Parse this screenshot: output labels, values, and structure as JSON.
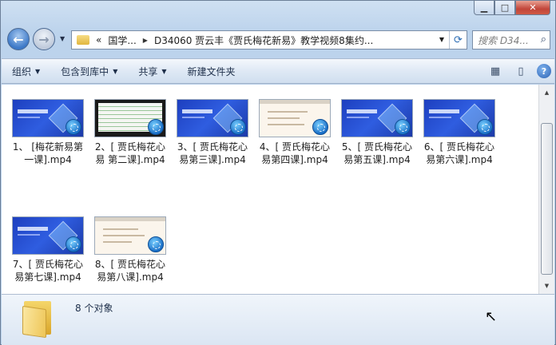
{
  "window": {
    "caption_buttons": {
      "minimize": "▁",
      "maximize": "□",
      "close": "✕"
    }
  },
  "nav": {
    "back_icon": "back-arrow-icon",
    "forward_icon": "forward-arrow-icon",
    "address": {
      "overflow": "«",
      "crumbs": [
        "国学...",
        "D34060 贾云丰《贾氏梅花新易》教学视频8集约..."
      ]
    },
    "search_placeholder": "搜索 D34..."
  },
  "toolbar": {
    "organize": "组织",
    "include_library": "包含到库中",
    "share": "共享",
    "new_folder": "新建文件夹"
  },
  "files": [
    {
      "name": "1、 [梅花新易第\n一课].mp4",
      "thumb": "blue"
    },
    {
      "name": "2、[ 贾氏梅花心\n易 第二课].mp4",
      "thumb": "table"
    },
    {
      "name": "3、[ 贾氏梅花心\n易第三课].mp4",
      "thumb": "blue"
    },
    {
      "name": "4、[ 贾氏梅花心\n易第四课].mp4",
      "thumb": "doc"
    },
    {
      "name": "5、[ 贾氏梅花心\n易第五课].mp4",
      "thumb": "blue"
    },
    {
      "name": "6、[ 贾氏梅花心\n易第六课].mp4",
      "thumb": "blue"
    },
    {
      "name": "7、[ 贾氏梅花心\n易第七课].mp4",
      "thumb": "blue"
    },
    {
      "name": "8、[ 贾氏梅花心\n易第八课].mp4",
      "thumb": "doc"
    }
  ],
  "status": {
    "count_text": "8 个对象"
  },
  "colors": {
    "accent": "#2f5de0",
    "toolbar_bg": "#dfe9f5",
    "window_frame": "#bcd3ec"
  }
}
